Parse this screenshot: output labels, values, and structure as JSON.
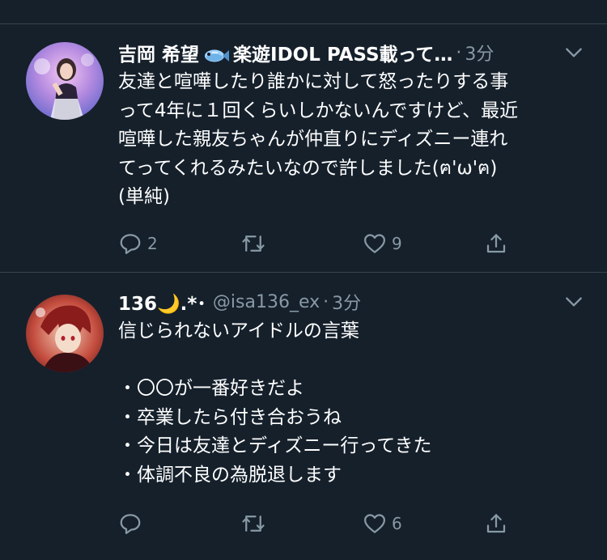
{
  "colors": {
    "background": "#15202b",
    "divider": "#38444d",
    "secondary_text": "#8899a6",
    "primary_text": "#ffffff"
  },
  "tweets": [
    {
      "display_name": "吉岡 希望",
      "display_name_suffix": "楽遊IDOL PASS載って…",
      "name_emoji": "fish-emoji",
      "handle": "",
      "separator": "·",
      "time": "3分",
      "text": "友達と喧嘩したり誰かに対して怒ったりする事\nって4年に１回くらいしかないんですけど、最近\n喧嘩した親友ちゃんが仲直りにディズニー連れ\nてってくれるみたいなので許しました(ฅ'ω'ฅ)\n(単純)",
      "reply_count": "2",
      "retweet_count": "",
      "like_count": "9"
    },
    {
      "display_name": "136🌙.*･",
      "handle": "@isa136_ex",
      "separator": "·",
      "time": "3分",
      "text": "信じられないアイドルの言葉\n\n・〇〇が一番好きだよ\n・卒業したら付き合おうね\n・今日は友達とディズニー行ってきた\n・体調不良の為脱退します",
      "reply_count": "",
      "retweet_count": "",
      "like_count": "6"
    }
  ],
  "icons": {
    "reply": "reply-icon",
    "retweet": "retweet-icon",
    "like": "heart-icon",
    "share": "share-icon",
    "more": "chevron-down-icon"
  }
}
